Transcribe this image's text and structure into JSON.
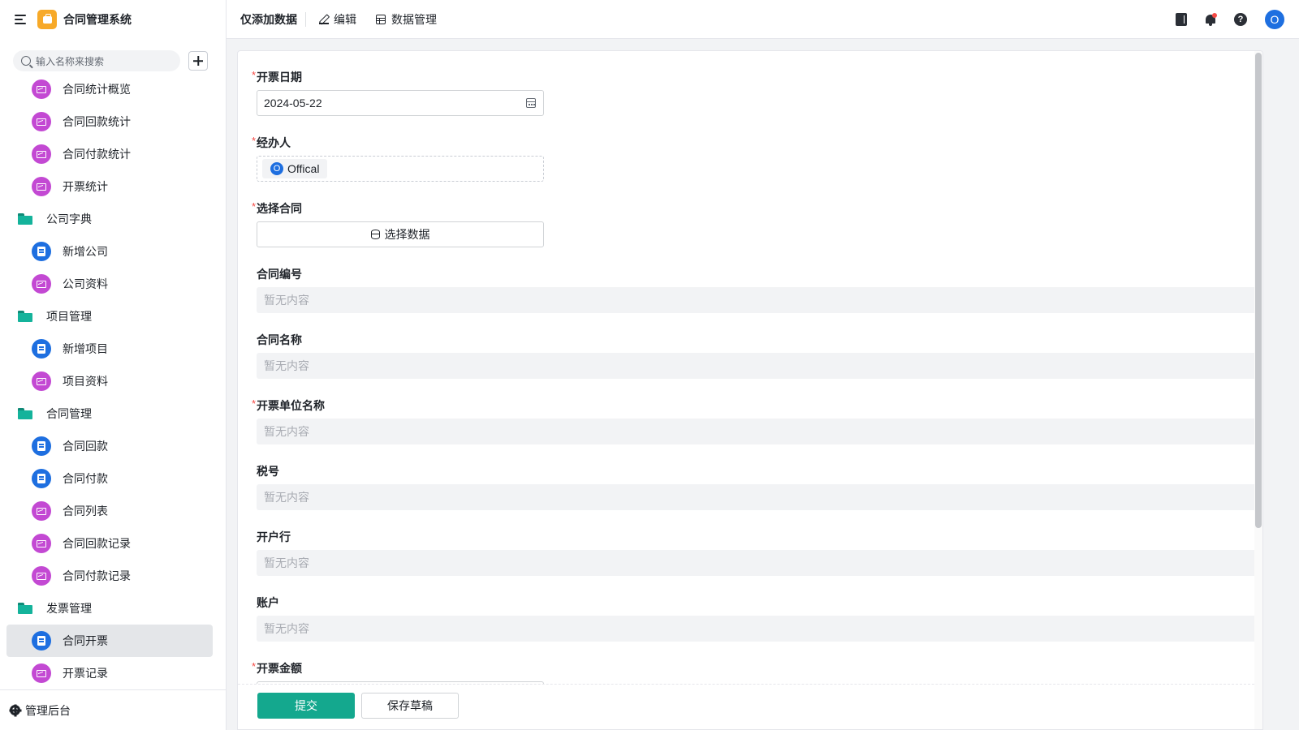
{
  "app": {
    "title": "合同管理系统"
  },
  "sidebar": {
    "search_placeholder": "输入名称来搜索",
    "items": [
      {
        "type": "chart",
        "label": "合同统计概览"
      },
      {
        "type": "chart",
        "label": "合同回款统计"
      },
      {
        "type": "chart",
        "label": "合同付款统计"
      },
      {
        "type": "chart",
        "label": "开票统计"
      },
      {
        "type": "folder",
        "label": "公司字典"
      },
      {
        "type": "form",
        "label": "新增公司"
      },
      {
        "type": "chart",
        "label": "公司资料"
      },
      {
        "type": "folder",
        "label": "项目管理"
      },
      {
        "type": "form",
        "label": "新增项目"
      },
      {
        "type": "chart",
        "label": "项目资料"
      },
      {
        "type": "folder",
        "label": "合同管理"
      },
      {
        "type": "form",
        "label": "合同回款"
      },
      {
        "type": "form",
        "label": "合同付款"
      },
      {
        "type": "chart",
        "label": "合同列表"
      },
      {
        "type": "chart",
        "label": "合同回款记录"
      },
      {
        "type": "chart",
        "label": "合同付款记录"
      },
      {
        "type": "folder",
        "label": "发票管理"
      },
      {
        "type": "form",
        "label": "合同开票",
        "active": true
      },
      {
        "type": "chart",
        "label": "开票记录"
      }
    ],
    "footer_label": "管理后台"
  },
  "topbar": {
    "title": "仅添加数据",
    "edit_label": "编辑",
    "data_manage_label": "数据管理",
    "avatar_initial": "O",
    "help_glyph": "?"
  },
  "form": {
    "invoice_date": {
      "label": "开票日期",
      "required": "*",
      "value": "2024-05-22"
    },
    "handler": {
      "label": "经办人",
      "required": "*",
      "user_initial": "O",
      "user_name": "Offical"
    },
    "contract": {
      "label": "选择合同",
      "required": "*",
      "button_label": "选择数据"
    },
    "contract_no": {
      "label": "合同编号",
      "placeholder": "暂无内容"
    },
    "contract_name": {
      "label": "合同名称",
      "placeholder": "暂无内容"
    },
    "invoice_unit": {
      "label": "开票单位名称",
      "required": "*",
      "placeholder": "暂无内容"
    },
    "tax_no": {
      "label": "税号",
      "placeholder": "暂无内容"
    },
    "bank": {
      "label": "开户行",
      "placeholder": "暂无内容"
    },
    "account": {
      "label": "账户",
      "placeholder": "暂无内容"
    },
    "invoice_amount": {
      "label": "开票金额",
      "required": "*"
    }
  },
  "actions": {
    "submit_label": "提交",
    "draft_label": "保存草稿"
  },
  "colors": {
    "primary": "#14a88e",
    "accent_blue": "#1e6fe0",
    "chart_purple": "#c349d3",
    "folder_teal": "#14b39b",
    "required_red": "#f54a45"
  }
}
